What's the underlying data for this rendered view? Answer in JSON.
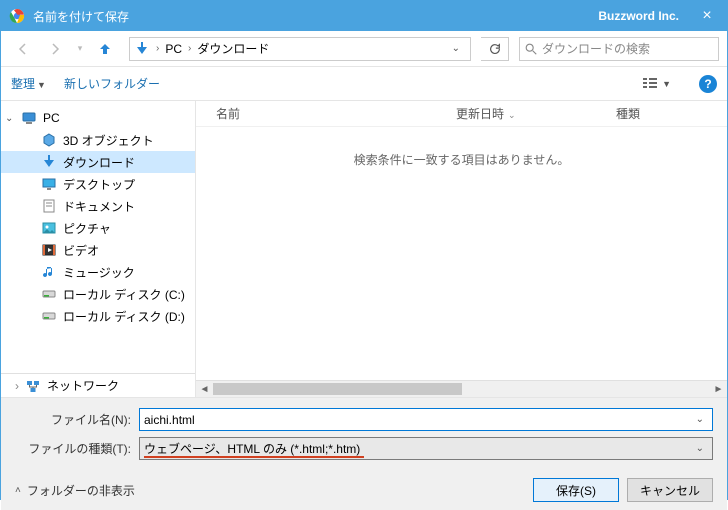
{
  "titlebar": {
    "title": "名前を付けて保存",
    "brand": "Buzzword Inc."
  },
  "breadcrumb": {
    "root": "PC",
    "current": "ダウンロード"
  },
  "search": {
    "placeholder": "ダウンロードの検索"
  },
  "toolbar": {
    "organize": "整理",
    "new_folder": "新しいフォルダー"
  },
  "sidebar": {
    "pc": "PC",
    "items": [
      {
        "label": "3D オブジェクト",
        "icon": "cube"
      },
      {
        "label": "ダウンロード",
        "icon": "download",
        "selected": true
      },
      {
        "label": "デスクトップ",
        "icon": "desktop"
      },
      {
        "label": "ドキュメント",
        "icon": "document"
      },
      {
        "label": "ピクチャ",
        "icon": "picture"
      },
      {
        "label": "ビデオ",
        "icon": "video"
      },
      {
        "label": "ミュージック",
        "icon": "music"
      },
      {
        "label": "ローカル ディスク (C:)",
        "icon": "disk"
      },
      {
        "label": "ローカル ディスク (D:)",
        "icon": "disk"
      }
    ],
    "network": "ネットワーク"
  },
  "columns": {
    "name": "名前",
    "date": "更新日時",
    "type": "種類"
  },
  "content": {
    "empty_message": "検索条件に一致する項目はありません。"
  },
  "fields": {
    "filename_label": "ファイル名(N):",
    "filename_value": "aichi.html",
    "filetype_label": "ファイルの種類(T):",
    "filetype_value": "ウェブページ、HTML のみ (*.html;*.htm)"
  },
  "footer": {
    "hide_folders": "フォルダーの非表示",
    "save": "保存(S)",
    "cancel": "キャンセル"
  }
}
